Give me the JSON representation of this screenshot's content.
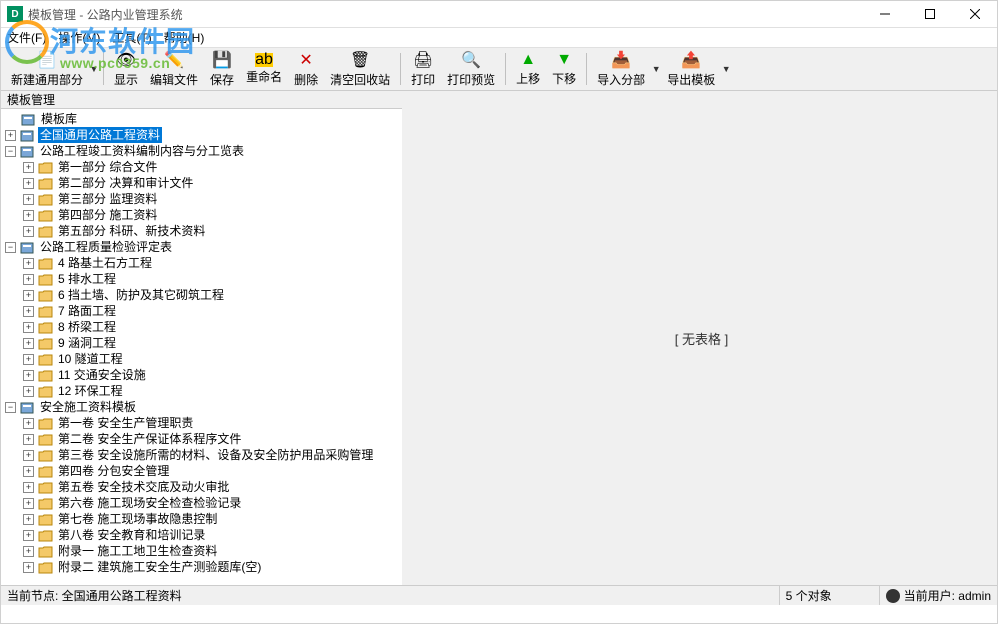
{
  "window": {
    "title": "模板管理 - 公路内业管理系统"
  },
  "menubar": {
    "file": "文件(F)",
    "operate": "操作(M)",
    "tools": "工具(T)",
    "help": "帮助(H)"
  },
  "toolbar": {
    "new_general": "新建通用部分",
    "show": "显示",
    "edit_file": "编辑文件",
    "save": "保存",
    "rename": "重命名",
    "delete": "删除",
    "empty_recycle": "清空回收站",
    "print": "打印",
    "print_preview": "打印预览",
    "move_up": "上移",
    "move_down": "下移",
    "import_part": "导入分部",
    "export_template": "导出模板"
  },
  "panel": {
    "header": "模板管理"
  },
  "tree": {
    "root": "模板库",
    "sel": "全国通用公路工程资料",
    "g1": "公路工程竣工资料编制内容与分工览表",
    "g1_items": [
      "第一部分    综合文件",
      "第二部分    决算和审计文件",
      "第三部分    监理资料",
      "第四部分    施工资料",
      "第五部分    科研、新技术资料"
    ],
    "g2": "公路工程质量检验评定表",
    "g2_items": [
      "4  路基土石方工程",
      "5  排水工程",
      "6  挡土墙、防护及其它砌筑工程",
      "7  路面工程",
      "8  桥梁工程",
      "9  涵洞工程",
      "10  隧道工程",
      "11    交通安全设施",
      "12 环保工程"
    ],
    "g3": "安全施工资料模板",
    "g3_items": [
      "第一卷    安全生产管理职责",
      "第二卷    安全生产保证体系程序文件",
      "第三卷    安全设施所需的材料、设备及安全防护用品采购管理",
      "第四卷    分包安全管理",
      "第五卷    安全技术交底及动火审批",
      "第六卷    施工现场安全检查检验记录",
      "第七卷    施工现场事故隐患控制",
      "第八卷    安全教育和培训记录",
      "附录一    施工工地卫生检查资料",
      "附录二    建筑施工安全生产测验题库(空)"
    ]
  },
  "right_panel": {
    "no_table": "[  无表格  ]"
  },
  "statusbar": {
    "current_node": "当前节点:  全国通用公路工程资料",
    "object_count": "5 个对象",
    "current_user": "当前用户:  admin"
  },
  "watermark": {
    "text": "河东软件园",
    "url": "www.pc0359.cn"
  }
}
